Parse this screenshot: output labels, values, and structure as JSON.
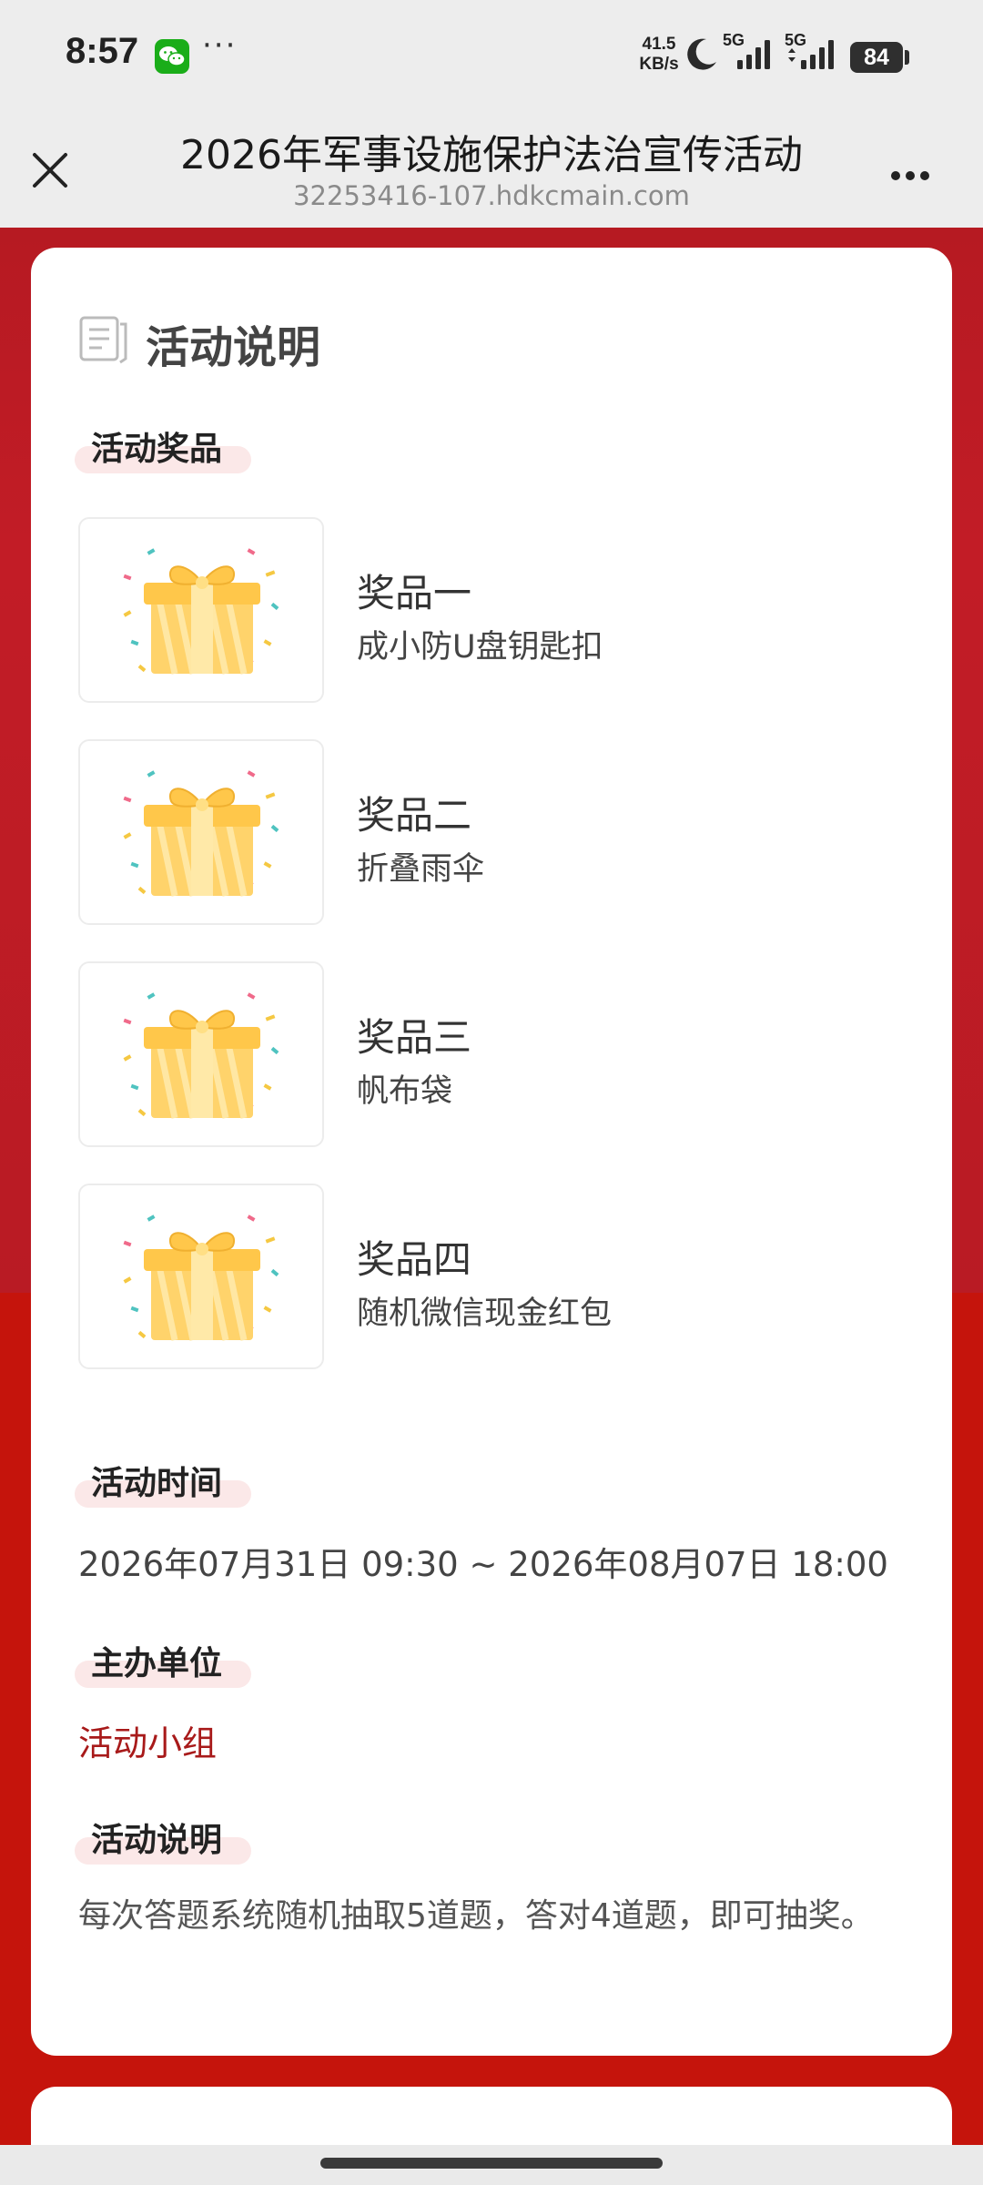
{
  "status_bar": {
    "time": "8:57",
    "more": "···",
    "net_speed_value": "41.5",
    "net_speed_unit": "KB/s",
    "signal_1_label": "5G",
    "signal_2_label": "5G",
    "battery": "84",
    "icons": [
      "wechat-icon",
      "moon-icon",
      "signal-icon",
      "signal-icon",
      "battery-icon"
    ]
  },
  "title_bar": {
    "title": "2026年军事设施保护法治宣传活动",
    "url": "32253416-107.hdkcmain.com",
    "icons": [
      "close-icon",
      "more-icon"
    ]
  },
  "card": {
    "heading": "活动说明",
    "heading_icon": "document-icon",
    "prizes_label": "活动奖品",
    "prizes": [
      {
        "title": "奖品一",
        "desc": "成小防U盘钥匙扣",
        "icon": "gift-box-icon"
      },
      {
        "title": "奖品二",
        "desc": "折叠雨伞",
        "icon": "gift-box-icon"
      },
      {
        "title": "奖品三",
        "desc": "帆布袋",
        "icon": "gift-box-icon"
      },
      {
        "title": "奖品四",
        "desc": "随机微信现金红包",
        "icon": "gift-box-icon"
      }
    ],
    "time_label": "活动时间",
    "time_value": "2026年07月31日 09:30 ~ 2026年08月07日 18:00",
    "organizer_label": "主办单位",
    "organizer_value": "活动小组",
    "desc_label": "活动说明",
    "desc_value": "每次答题系统随机抽取5道题，答对4道题，即可抽奖。"
  },
  "colors": {
    "background_red": "#c5140c",
    "header_red": "#b61a22",
    "tag_highlight": "#fbe8e8",
    "organizer_text": "#a81a1a"
  }
}
